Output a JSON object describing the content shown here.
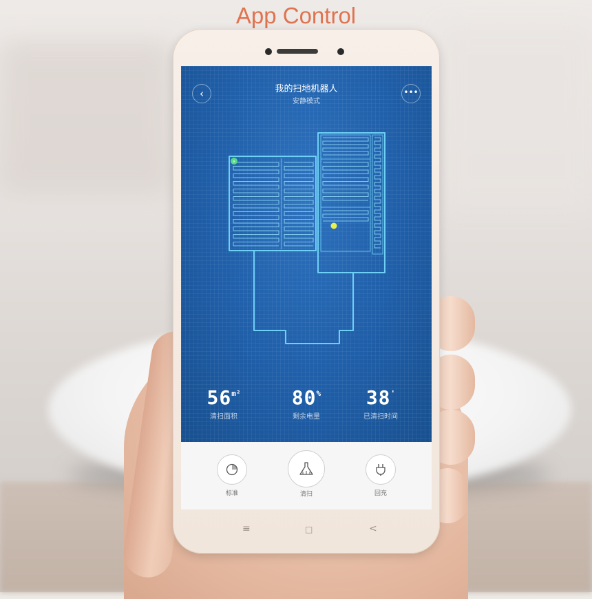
{
  "caption": "App Control",
  "app": {
    "title": "我的扫地机器人",
    "subtitle": "安静模式",
    "back_icon": "back-arrow-icon",
    "more_icon": "more-icon"
  },
  "stats": [
    {
      "value": "56",
      "unit": "m²",
      "label": "清扫面积"
    },
    {
      "value": "80",
      "unit": "%",
      "label": "剩余电量"
    },
    {
      "value": "38",
      "unit": "'",
      "label": "已清扫时间"
    }
  ],
  "controls": [
    {
      "label": "标准",
      "icon": "timer-icon"
    },
    {
      "label": "清扫",
      "icon": "broom-icon"
    },
    {
      "label": "回充",
      "icon": "plug-icon"
    }
  ],
  "nav_keys": {
    "menu": "≡",
    "home": "□",
    "back": "<"
  },
  "colors": {
    "caption": "#e0734f",
    "screen_blue": "#1f5ea8",
    "map_line": "#6fd0f5",
    "robot_dot": "#e8f24a",
    "dock": "#57d98a"
  }
}
